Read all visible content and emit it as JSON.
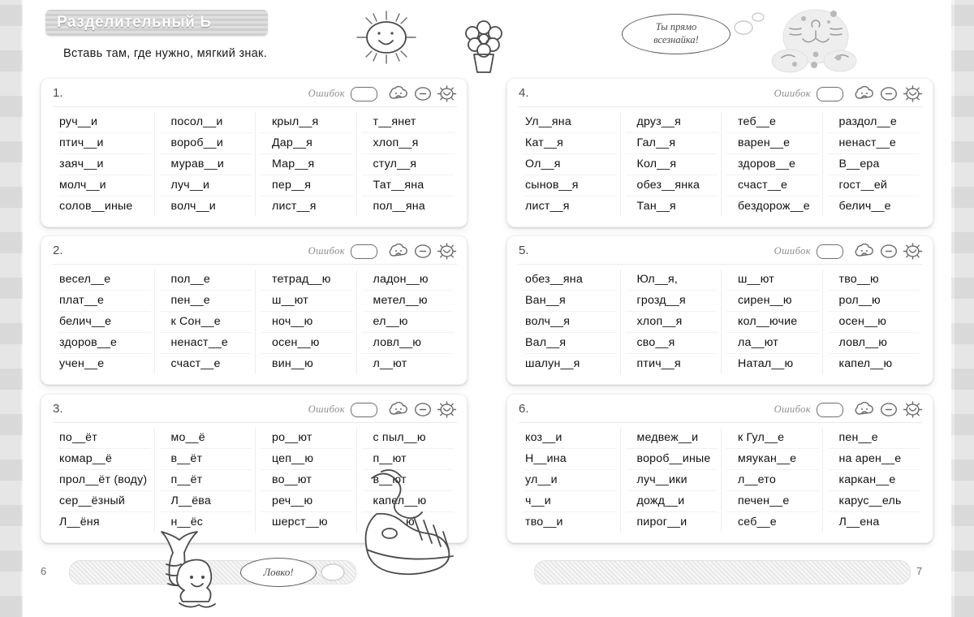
{
  "header": {
    "title": "Разделительный Ь",
    "instruction": "Вставь там, где нужно, мягкий знак."
  },
  "labels": {
    "errors": "Ошибок",
    "mood_sad": "cloud-sad-icon",
    "mood_neutral": "neutral-face-icon",
    "mood_happy": "sun-happy-icon"
  },
  "pages": {
    "left": "6",
    "right": "7"
  },
  "doodles": {
    "top_bubble": "Ты прямо\nвсезнайка!",
    "top_bubble_line1": "Ты прямо",
    "top_bubble_line2": "всезнайка!",
    "bottom_bubble": "Ловко!",
    "sun": "smiling-sun-doodle",
    "flower": "flower-in-pot-doodle",
    "cat": "cat-doodle",
    "mermaid": "mermaid-doodle",
    "shoe": "sneaker-doodle"
  },
  "exercises": [
    {
      "number": "1.",
      "columns": [
        [
          "руч__и",
          "птич__и",
          "заяч__и",
          "молч__и",
          "солов__иные"
        ],
        [
          "посол__и",
          "вороб__и",
          "мурав__и",
          "луч__и",
          "волч__и"
        ],
        [
          "крыл__я",
          "Дар__я",
          "Мар__я",
          "пер__я",
          "лист__я"
        ],
        [
          "т__янет",
          "хлоп__я",
          "стул__я",
          "Тат__яна",
          "пол__яна"
        ]
      ]
    },
    {
      "number": "2.",
      "columns": [
        [
          "весел__е",
          "плат__е",
          "белич__е",
          "здоров__е",
          "учен__е"
        ],
        [
          "пол__е",
          "пен__е",
          "к Сон__е",
          "ненаст__е",
          "счаст__е"
        ],
        [
          "тетрад__ю",
          "ш__ют",
          "ноч__ю",
          "осен__ю",
          "вин__ю"
        ],
        [
          "ладон__ю",
          "метел__ю",
          "ел__ю",
          "ловл__ю",
          "л__ют"
        ]
      ]
    },
    {
      "number": "3.",
      "columns": [
        [
          "по__ёт",
          "комар__ё",
          "прол__ёт (воду)",
          "сер__ёзный",
          "Л__ёня"
        ],
        [
          "мо__ё",
          "в__ёт",
          "п__ёт",
          "Л__ёва",
          "н__ёс"
        ],
        [
          "ро__ют",
          "цеп__ю",
          "во__ют",
          "реч__ю",
          "шерст__ю"
        ],
        [
          "с пыл__ю",
          "п__ют",
          "в__ют",
          "капел__ю",
          "цел__ю"
        ]
      ]
    },
    {
      "number": "4.",
      "columns": [
        [
          "Ул__яна",
          "Кат__я",
          "Ол__я",
          "сынов__я",
          "лист__я"
        ],
        [
          "друз__я",
          "Гал__я",
          "Кол__я",
          "обез__янка",
          "Тан__я"
        ],
        [
          "теб__е",
          "варен__е",
          "здоров__е",
          "счаст__е",
          "бездорож__е"
        ],
        [
          "раздол__е",
          "ненаст__е",
          "В__ера",
          "гост__ей",
          "белич__е"
        ]
      ]
    },
    {
      "number": "5.",
      "columns": [
        [
          "обез__яна",
          "Ван__я",
          "волч__я",
          "Вал__я",
          "шалун__я"
        ],
        [
          "Юл__я,",
          "грозд__я",
          "хлоп__я",
          "сво__я",
          "птич__я"
        ],
        [
          "ш__ют",
          "сирен__ю",
          "кол__ючие",
          "ла__ют",
          "Натал__ю"
        ],
        [
          "тво__ю",
          "рол__ю",
          "осен__ю",
          "ловл__ю",
          "капел__ю"
        ]
      ]
    },
    {
      "number": "6.",
      "columns": [
        [
          "коз__и",
          "Н__ина",
          "ул__и",
          "ч__и",
          "тво__и"
        ],
        [
          "медвеж__и",
          "вороб__иные",
          "луч__ики",
          "дожд__и",
          "пирог__и"
        ],
        [
          "к Гул__е",
          "мяукан__е",
          "л__ето",
          "печен__е",
          "себ__е"
        ],
        [
          "пен__е",
          "на арен__е",
          "каркан__е",
          "карус__ель",
          "Л__ена"
        ]
      ]
    }
  ]
}
